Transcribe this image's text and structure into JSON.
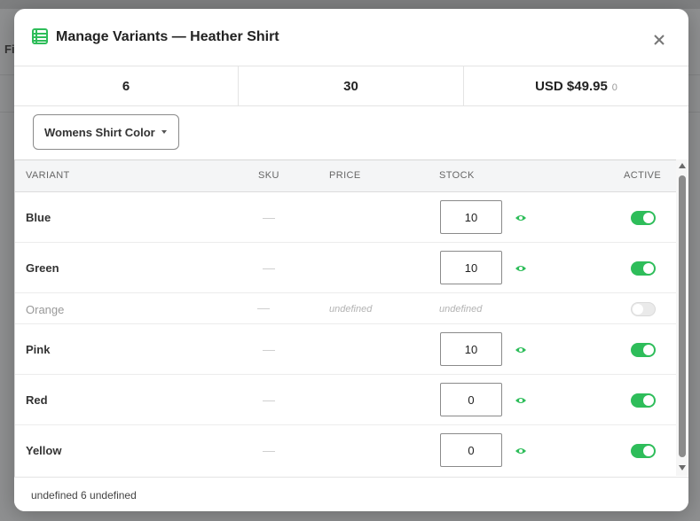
{
  "background": {
    "partial_label": "Fil"
  },
  "modal": {
    "title": "Manage Variants — Heather Shirt",
    "title_icon": "table-list-icon",
    "close_icon": "close-icon"
  },
  "stats": {
    "variant_count": "6",
    "total_stock": "30",
    "price": "USD $49.95",
    "price_suffix": "0"
  },
  "filter": {
    "selected": "Womens Shirt Color"
  },
  "table": {
    "headers": {
      "variant": "VARIANT",
      "sku": "SKU",
      "price": "PRICE",
      "stock": "STOCK",
      "active": "ACTIVE"
    },
    "rows": [
      {
        "name": "Blue",
        "stock": "10",
        "active": true
      },
      {
        "name": "Green",
        "stock": "10",
        "active": true
      },
      {
        "name": "Orange",
        "price": "undefined",
        "stock": "undefined",
        "active": false
      },
      {
        "name": "Pink",
        "stock": "10",
        "active": true
      },
      {
        "name": "Red",
        "stock": "0",
        "active": true
      },
      {
        "name": "Yellow",
        "stock": "0",
        "active": true
      }
    ]
  },
  "footer": {
    "text": "undefined 6 undefined"
  },
  "colors": {
    "accent_green": "#2ebd5a",
    "toggle_off": "#eaeaea"
  }
}
